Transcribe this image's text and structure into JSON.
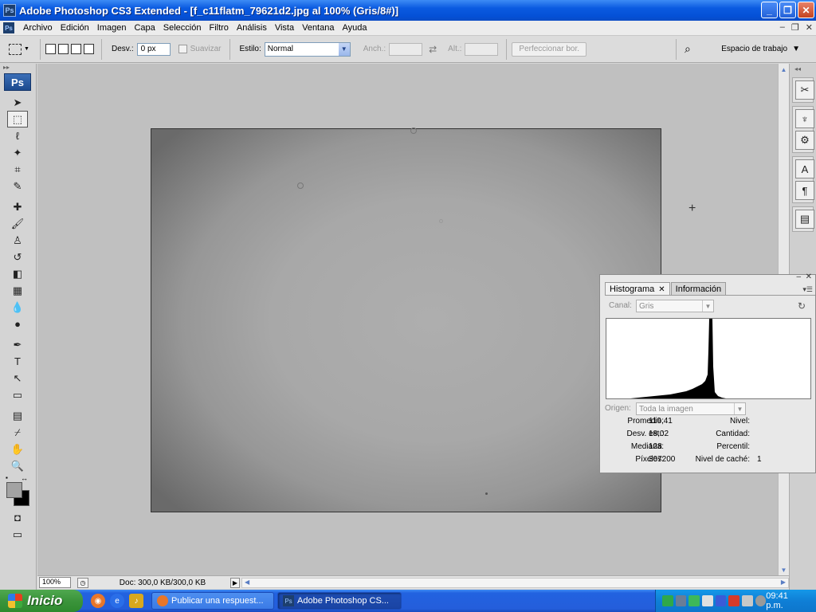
{
  "window": {
    "title": "Adobe Photoshop CS3 Extended - [f_c11flatm_79621d2.jpg al 100% (Gris/8#)]",
    "app_badge": "Ps",
    "minimize_glyph": "_",
    "restore_glyph": "❐",
    "close_glyph": "✕"
  },
  "menu": {
    "items": [
      "Archivo",
      "Edición",
      "Imagen",
      "Capa",
      "Selección",
      "Filtro",
      "Análisis",
      "Vista",
      "Ventana",
      "Ayuda"
    ],
    "doc_minimize": "–",
    "doc_restore": "❐",
    "doc_close": "✕"
  },
  "options": {
    "feather_label": "Desv.:",
    "feather_value": "0 px",
    "antialias_label": "Suavizar",
    "style_label": "Estilo:",
    "style_value": "Normal",
    "width_label": "Anch.:",
    "height_label": "Alt.:",
    "refine_label": "Perfeccionar bor.",
    "workspace_label": "Espacio de trabajo"
  },
  "toolbox": {
    "logo": "Ps",
    "tools": [
      {
        "name": "move-tool",
        "glyph": "➤"
      },
      {
        "name": "marquee-tool",
        "glyph": "⬚",
        "active": true
      },
      {
        "name": "lasso-tool",
        "glyph": "ℓ"
      },
      {
        "name": "magic-wand-tool",
        "glyph": "✦"
      },
      {
        "name": "crop-tool",
        "glyph": "⌗"
      },
      {
        "name": "slice-tool",
        "glyph": "✎"
      },
      {
        "name": "healing-brush-tool",
        "glyph": "✚"
      },
      {
        "name": "brush-tool",
        "glyph": "🖌"
      },
      {
        "name": "clone-stamp-tool",
        "glyph": "♙"
      },
      {
        "name": "history-brush-tool",
        "glyph": "↺"
      },
      {
        "name": "eraser-tool",
        "glyph": "◧"
      },
      {
        "name": "gradient-tool",
        "glyph": "▦"
      },
      {
        "name": "blur-tool",
        "glyph": "💧"
      },
      {
        "name": "dodge-tool",
        "glyph": "●"
      },
      {
        "name": "pen-tool",
        "glyph": "✒"
      },
      {
        "name": "type-tool",
        "glyph": "T"
      },
      {
        "name": "path-selection-tool",
        "glyph": "↖"
      },
      {
        "name": "shape-tool",
        "glyph": "▭"
      },
      {
        "name": "notes-tool",
        "glyph": "▤"
      },
      {
        "name": "eyedropper-tool",
        "glyph": "⌿"
      },
      {
        "name": "hand-tool",
        "glyph": "✋"
      },
      {
        "name": "zoom-tool",
        "glyph": "🔍"
      }
    ],
    "colors": {
      "foreground": "#a3a3a3",
      "background": "#000000"
    }
  },
  "status": {
    "zoom": "100%",
    "doc_info": "Doc: 300,0 KB/300,0 KB"
  },
  "histogram_panel": {
    "tabs": [
      {
        "label": "Histograma",
        "active": true,
        "close": "✕"
      },
      {
        "label": "Información",
        "active": false
      }
    ],
    "channel_label": "Canal:",
    "channel_value": "Gris",
    "source_label": "Origen:",
    "source_value": "Toda la imagen",
    "stats_left": [
      {
        "label": "Promedio:",
        "value": "119,41"
      },
      {
        "label": "Desv. est.:",
        "value": "18,02"
      },
      {
        "label": "Mediana:",
        "value": "128"
      },
      {
        "label": "Píxeles:",
        "value": "307200"
      }
    ],
    "stats_right": [
      {
        "label": "Nivel:",
        "value": ""
      },
      {
        "label": "Cantidad:",
        "value": ""
      },
      {
        "label": "Percentil:",
        "value": ""
      },
      {
        "label": "Nivel de caché:",
        "value": "1"
      }
    ]
  },
  "taskbar": {
    "start_label": "Inicio",
    "tasks": [
      {
        "label": "Publicar una respuest...",
        "active": false
      },
      {
        "label": "Adobe Photoshop CS...",
        "active": true
      }
    ],
    "clock": "09:41 p.m."
  }
}
